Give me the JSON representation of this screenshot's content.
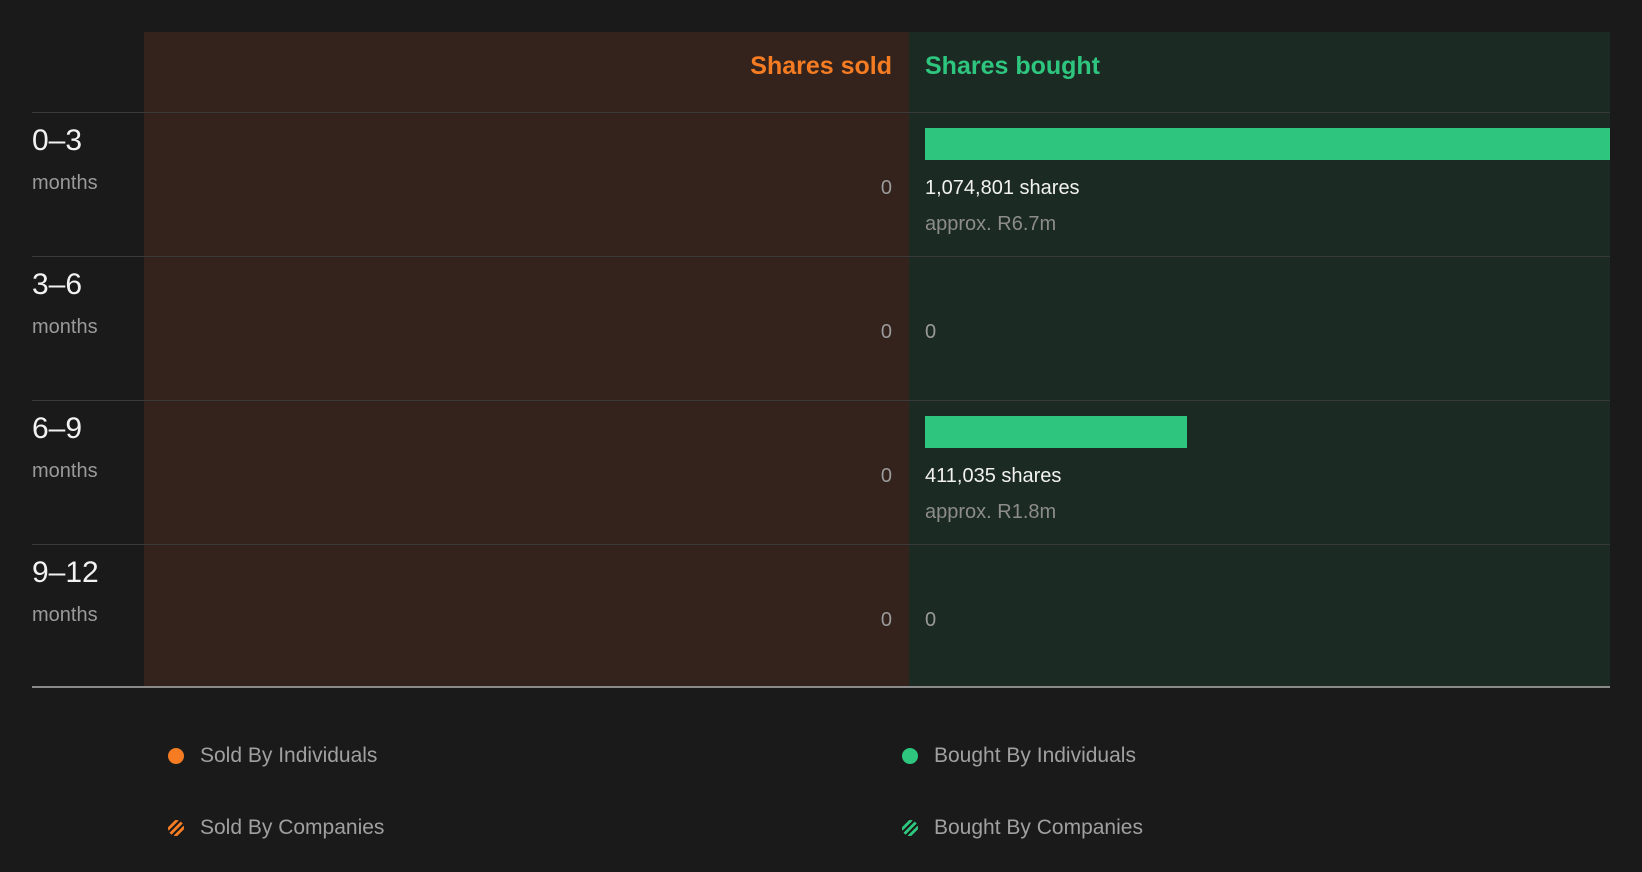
{
  "colors": {
    "sold": "#f57c22",
    "bought": "#2ec67e"
  },
  "chart_data": {
    "type": "bar",
    "orientation": "horizontal-diverging",
    "columns": {
      "sold": "Shares sold",
      "bought": "Shares bought"
    },
    "categories": [
      {
        "range": "0-3",
        "unit": "months"
      },
      {
        "range": "3-6",
        "unit": "months"
      },
      {
        "range": "6-9",
        "unit": "months"
      },
      {
        "range": "9-12",
        "unit": "months"
      }
    ],
    "series": [
      {
        "key": "sold",
        "values": [
          0,
          0,
          0,
          0
        ],
        "value_labels": [
          "0",
          "0",
          "0",
          "0"
        ]
      },
      {
        "key": "bought",
        "values": [
          1074801,
          0,
          411035,
          0
        ],
        "value_labels": [
          "1,074,801 shares",
          "0",
          "411,035 shares",
          "0"
        ],
        "approx_labels": [
          "approx. R6.7m",
          "",
          "approx. R1.8m",
          ""
        ]
      }
    ],
    "xlim_bought": [
      0,
      1074801
    ]
  },
  "legend": [
    {
      "label": "Sold By Individuals",
      "marker": "dot",
      "color": "#f57c22"
    },
    {
      "label": "Bought By Individuals",
      "marker": "dot",
      "color": "#2ec67e"
    },
    {
      "label": "Sold By Companies",
      "marker": "hatched-dot",
      "color": "#f57c22"
    },
    {
      "label": "Bought By Companies",
      "marker": "hatched-dot",
      "color": "#2ec67e"
    }
  ]
}
